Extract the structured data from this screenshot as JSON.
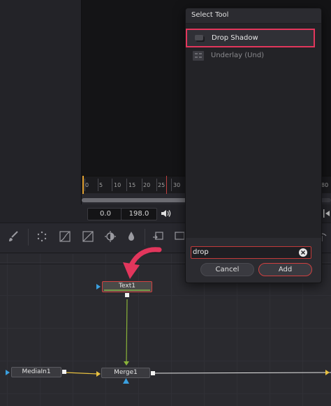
{
  "dialog": {
    "title": "Select Tool",
    "items": [
      {
        "label": "Drop Shadow",
        "icon": "shadow-tool-icon",
        "highlighted": true
      },
      {
        "label": "Underlay (Und)",
        "icon": "underlay-tool-icon",
        "highlighted": false
      }
    ],
    "search_value": "drop",
    "cancel_label": "Cancel",
    "add_label": "Add"
  },
  "timeline": {
    "ruler_ticks": [
      "0",
      "5",
      "10",
      "15",
      "20",
      "25",
      "30",
      "80"
    ],
    "start_time": "0.0",
    "end_time": "198.0"
  },
  "nodes": {
    "text1": "Text1",
    "media_in": "MediaIn1",
    "merge": "Merge1"
  },
  "colors": {
    "highlight": "#e2365c",
    "accent_red": "#d04040",
    "connection_green": "#8ab43a",
    "connection_yellow": "#e8c040",
    "input_blue": "#3aa0e0"
  }
}
